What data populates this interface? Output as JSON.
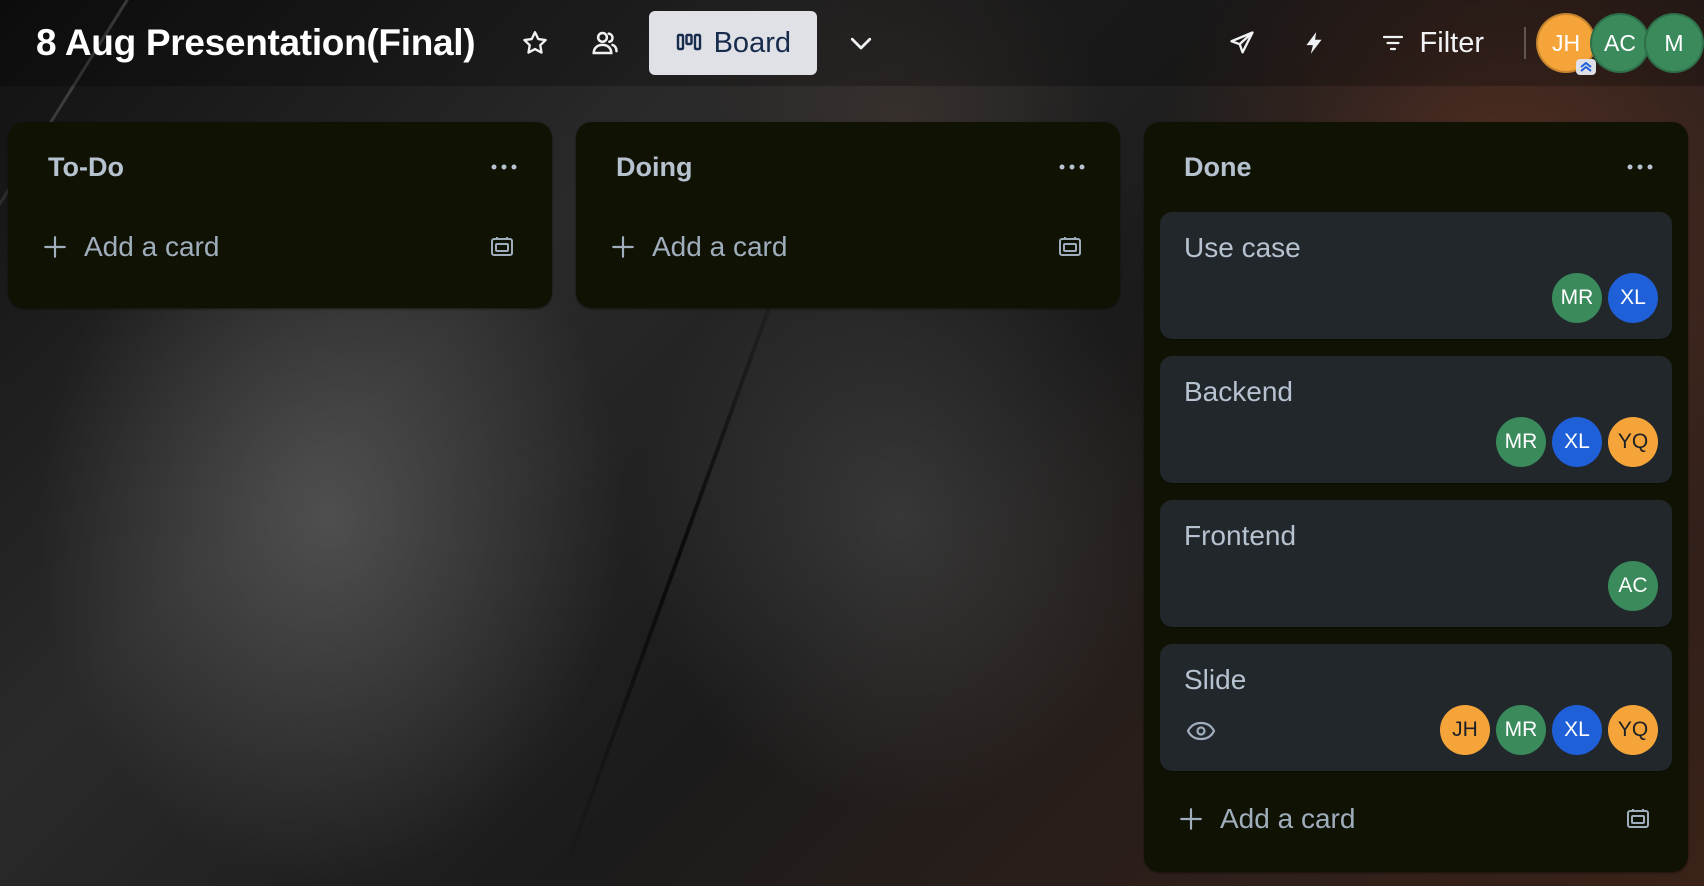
{
  "board": {
    "title": "8 Aug Presentation(Final)",
    "view_label": "Board",
    "filter_label": "Filter",
    "members": [
      {
        "initials": "JH",
        "color": "#f5a43a",
        "admin": true
      },
      {
        "initials": "AC",
        "color": "#3a8a5c",
        "admin": false
      },
      {
        "initials": "M",
        "color": "#3a8a5c",
        "admin": false
      }
    ]
  },
  "lists": [
    {
      "title": "To-Do",
      "add_label": "Add a card",
      "cards": []
    },
    {
      "title": "Doing",
      "add_label": "Add a card",
      "cards": []
    },
    {
      "title": "Done",
      "add_label": "Add a card",
      "cards": [
        {
          "title": "Use case",
          "watching": false,
          "members": [
            {
              "initials": "MR",
              "color": "#3a8a5c",
              "text": "light"
            },
            {
              "initials": "XL",
              "color": "#1f5fd8",
              "text": "light"
            }
          ]
        },
        {
          "title": "Backend",
          "watching": false,
          "members": [
            {
              "initials": "MR",
              "color": "#3a8a5c",
              "text": "light"
            },
            {
              "initials": "XL",
              "color": "#1f5fd8",
              "text": "light"
            },
            {
              "initials": "YQ",
              "color": "#f5a43a",
              "text": "dark"
            }
          ]
        },
        {
          "title": "Frontend",
          "watching": false,
          "members": [
            {
              "initials": "AC",
              "color": "#3a8a5c",
              "text": "light"
            }
          ]
        },
        {
          "title": "Slide",
          "watching": true,
          "members": [
            {
              "initials": "JH",
              "color": "#f5a43a",
              "text": "dark"
            },
            {
              "initials": "MR",
              "color": "#3a8a5c",
              "text": "light"
            },
            {
              "initials": "XL",
              "color": "#1f5fd8",
              "text": "light"
            },
            {
              "initials": "YQ",
              "color": "#f5a43a",
              "text": "dark"
            }
          ]
        }
      ]
    }
  ],
  "icons": {
    "star": "star-icon",
    "people": "people-icon",
    "board": "board-icon",
    "chevron": "chevron-down-icon",
    "plane": "paper-plane-icon",
    "bolt": "lightning-icon",
    "filter": "filter-icon",
    "more": "more-icon",
    "plus": "plus-icon",
    "template": "card-template-icon",
    "watch": "eye-icon"
  }
}
